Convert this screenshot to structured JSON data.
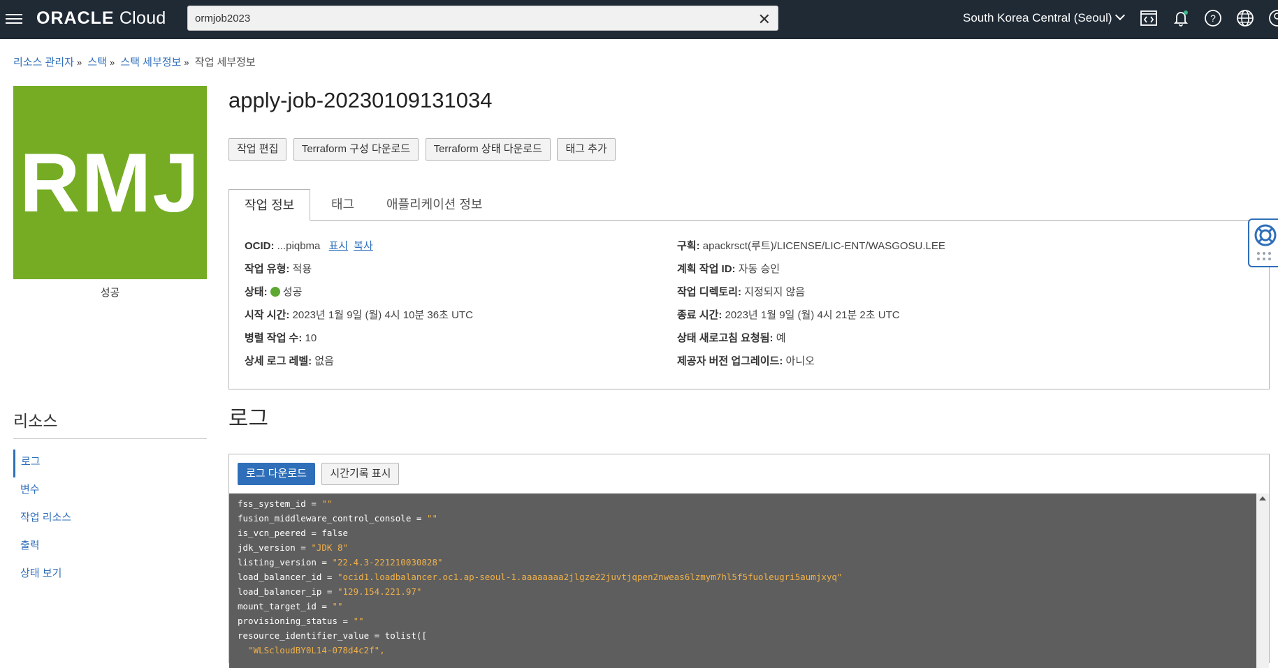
{
  "topbar": {
    "brand_oracle": "ORACLE",
    "brand_cloud": "Cloud",
    "search_value": "ormjob2023",
    "region": "South Korea Central (Seoul)"
  },
  "breadcrumb": [
    "리소스 관리자",
    "스택",
    "스택 세부정보",
    "작업 세부정보"
  ],
  "logo": {
    "initials": "RMJ",
    "status": "성공",
    "color": "#75ac24"
  },
  "resources": {
    "title": "리소스",
    "items": [
      "로그",
      "변수",
      "작업 리소스",
      "출력",
      "상태 보기"
    ]
  },
  "job": {
    "title": "apply-job-20230109131034",
    "buttons": [
      "작업 편집",
      "Terraform 구성 다운로드",
      "Terraform 상태 다운로드",
      "태그 추가"
    ],
    "tabs": [
      "작업 정보",
      "태그",
      "애플리케이션 정보"
    ]
  },
  "info_left": {
    "ocid_label": "OCID:",
    "ocid_value": "...piqbma",
    "ocid_show": "표시",
    "ocid_copy": "복사",
    "type_label": "작업 유형:",
    "type_value": "적용",
    "status_label": "상태:",
    "status_value": "성공",
    "start_label": "시작 시간:",
    "start_value": "2023년 1월 9일 (월) 4시 10분 36초 UTC",
    "parallel_label": "병렬 작업 수:",
    "parallel_value": "10",
    "loglevel_label": "상세 로그 레벨:",
    "loglevel_value": "없음"
  },
  "info_right": {
    "compartment_label": "구획:",
    "compartment_value": "apackrsct(루트)/LICENSE/LIC-ENT/WASGOSU.LEE",
    "plan_label": "계획 작업 ID:",
    "plan_value": "자동 승인",
    "dir_label": "작업 디렉토리:",
    "dir_value": "지정되지 않음",
    "end_label": "종료 시간:",
    "end_value": "2023년 1월 9일 (월) 4시 21분 2초 UTC",
    "refresh_label": "상태 새로고침 요청됨:",
    "refresh_value": "예",
    "upgrade_label": "제공자 버전 업그레이드:",
    "upgrade_value": "아니오"
  },
  "logs": {
    "title": "로그",
    "download_button": "로그 다운로드",
    "timestamp_button": "시간기록 표시",
    "lines": [
      {
        "key": "fss_system_id = ",
        "val": "\"\""
      },
      {
        "key": "fusion_middleware_control_console = ",
        "val": "\"\""
      },
      {
        "key": "is_vcn_peered = false",
        "val": ""
      },
      {
        "key": "jdk_version = ",
        "val": "\"JDK 8\""
      },
      {
        "key": "listing_version = ",
        "val": "\"22.4.3-221210030828\""
      },
      {
        "key": "load_balancer_id = ",
        "val": "\"ocid1.loadbalancer.oc1.ap-seoul-1.aaaaaaaa2jlgze22juvtjqpen2nweas6lzmym7hl5f5fuoleugri5aumjxyq\""
      },
      {
        "key": "load_balancer_ip = ",
        "val": "\"129.154.221.97\""
      },
      {
        "key": "mount_target_id = ",
        "val": "\"\""
      },
      {
        "key": "provisioning_status = ",
        "val": "\"\""
      },
      {
        "key": "resource_identifier_value = tolist([",
        "val": ""
      },
      {
        "key": "  ",
        "val": "\"WLScloudBY0L14-078d4c2f\","
      }
    ]
  }
}
